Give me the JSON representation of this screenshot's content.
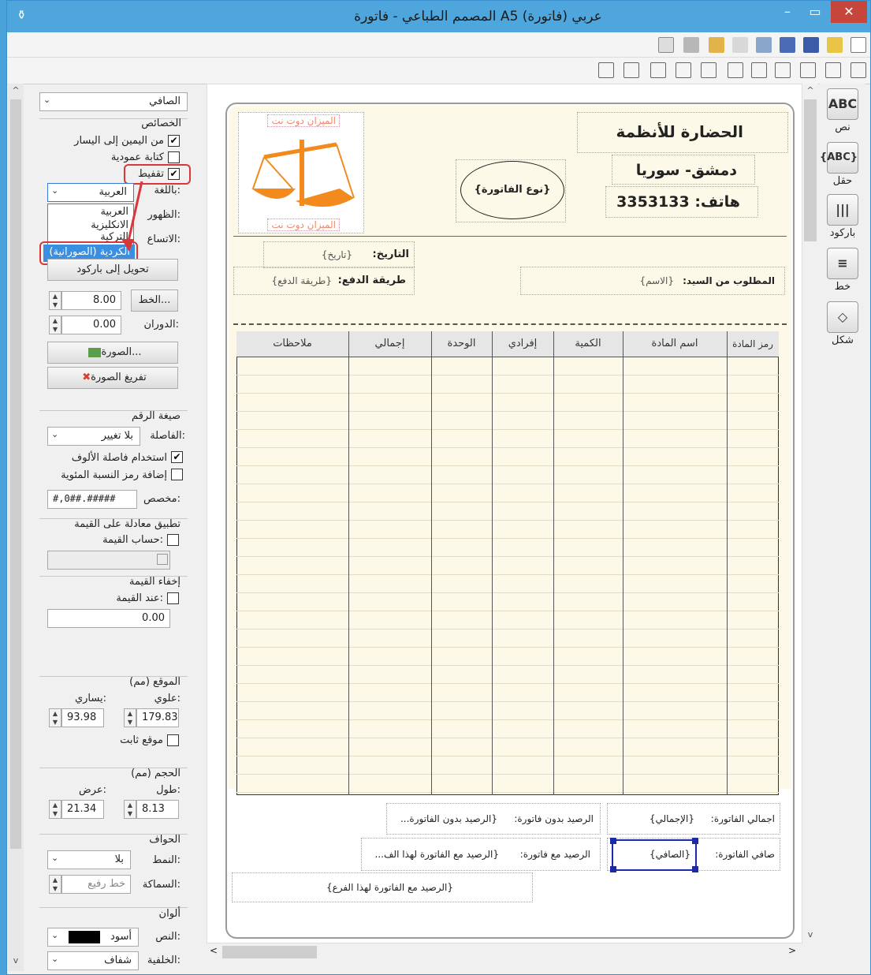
{
  "window": {
    "title": "المصمم الطباعي - فاتورة A5 عربي (فاتورة)",
    "min": "–",
    "max": "▭",
    "close": "✕"
  },
  "left": {
    "top_combo": "الصافي",
    "props_title": "الخصائص",
    "rtl": "من اليمين إلى اليسار",
    "vertical": "كتابة عمودية",
    "shape": "تقفيط",
    "lang_label": "باللغة:",
    "lang_value": "العربية",
    "lang_options": [
      "العربية",
      "الانكليزية",
      "التركية",
      "الكردية (الصورانية)"
    ],
    "appear_label": "الظهور:",
    "expand_label": "الاتساع:",
    "barcode_btn": "تحويل إلى باركود",
    "line_btn": "الخط...",
    "line_val": "8.00",
    "rot_label": "الدوران:",
    "rot_val": "0.00",
    "image_btn": "الصورة...",
    "clear_btn": "تفريغ الصورة",
    "numfmt_title": "صيغة الرقم",
    "sep_label": "الفاصلة:",
    "sep_val": "بلا تغيير",
    "thousands": "استخدام فاصلة الألوف",
    "percent": "إضافة رمز النسبة المئوية",
    "custom_label": "مخصص:",
    "custom_val": "#,0##.#####",
    "formula_title": "تطبيق معادلة على القيمة",
    "calc": "حساب القيمة:",
    "hide_title": "إخفاء القيمة",
    "when": "عند القيمة:",
    "when_val": "0.00",
    "pos_title": "الموقع (مم)",
    "top_lbl": "علوي:",
    "left_lbl": "يساري:",
    "top_val": "179.83",
    "left_val": "93.98",
    "fixed": "موقع ثابت",
    "size_title": "الحجم (مم)",
    "h_lbl": "طول:",
    "w_lbl": "عرض:",
    "h_val": "8.13",
    "w_val": "21.34",
    "borders_title": "الحواف",
    "style_lbl": "النمط:",
    "style_val": "بلا",
    "thick_lbl": "السماكة:",
    "thick_val": "خط رفيع",
    "colors_title": "ألوان",
    "text_lbl": "النص:",
    "text_val": "أسود",
    "bg_lbl": "الخلفية:",
    "bg_val": "شفاف"
  },
  "doc": {
    "company": "الحضارة للأنظمة",
    "city": "دمشق- سوريا",
    "phone": "هاتف: 3353133",
    "invoice_type": "{نوع الفاتورة}",
    "logo_top": "الميزان دوت نت",
    "logo_bottom": "الميزان دوت نت",
    "date_lbl": "التاريخ:",
    "date_val": "{تاريخ}",
    "pay_lbl": "طريقة الدفع:",
    "pay_val": "{طريقة الدفع}",
    "cust_lbl": "المطلوب من السيد:",
    "cust_val": "{الاسم}",
    "cols": [
      "رمز المادة",
      "اسم المادة",
      "الكمية",
      "إفرادي",
      "الوحدة",
      "إجمالي",
      "ملاحظات"
    ],
    "total_lbl": "اجمالي الفاتورة:",
    "total_val": "{الإجمالي}",
    "bal_no_lbl": "الرصيد بدون فاتورة:",
    "bal_no_val": "{الرصيد بدون الفاتورة...",
    "net_lbl": "صافي الفاتورة:",
    "net_val": "{الصافي}",
    "bal_with_lbl": "الرصيد مع فاتورة:",
    "bal_with_val": "{الرصيد مع الفاتورة لهذا الف...",
    "bal_branch": "{الرصيد مع الفاتورة لهذا الفرع}"
  },
  "tools": [
    {
      "icon": "ABC",
      "label": "نص"
    },
    {
      "icon": "{ABC}",
      "label": "حقل"
    },
    {
      "icon": "|||",
      "label": "باركود"
    },
    {
      "icon": "≡",
      "label": "خط"
    },
    {
      "icon": "◇",
      "label": "شكل"
    }
  ]
}
